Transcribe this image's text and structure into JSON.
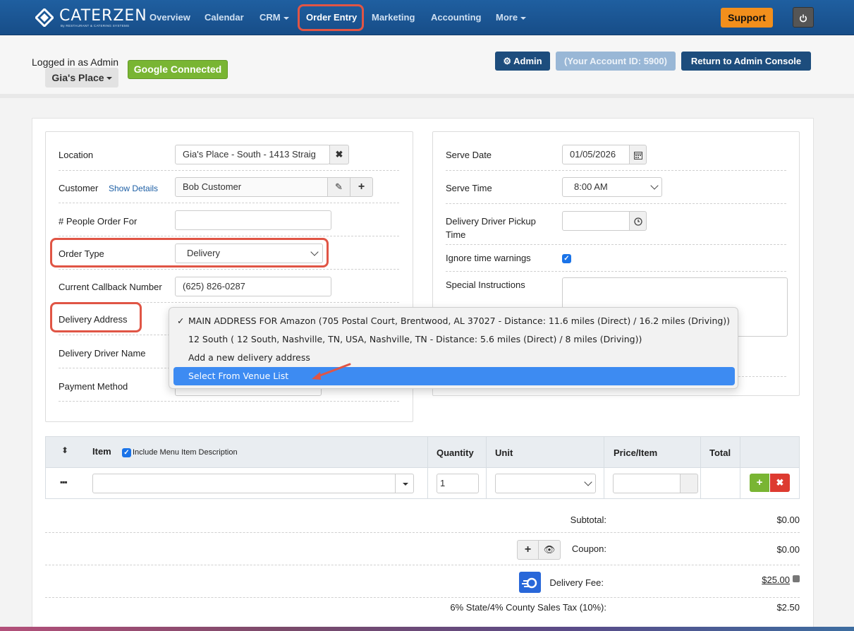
{
  "nav": {
    "logo_text": "CATERZEN",
    "logo_sub": "By RESTAURANT & CATERING SYSTEMS",
    "items": [
      {
        "label": "Overview"
      },
      {
        "label": "Calendar"
      },
      {
        "label": "CRM"
      },
      {
        "label": "Order Entry"
      },
      {
        "label": "Marketing"
      },
      {
        "label": "Accounting"
      },
      {
        "label": "More"
      }
    ],
    "support_label": "Support",
    "power_icon": "power-icon"
  },
  "header": {
    "logged_in": "Logged in as Admin",
    "account_menu": "Gia's Place",
    "google_status": "Google Connected",
    "admin_label": "Admin",
    "account_id": "(Your Account ID: 5900)",
    "return_label": "Return to Admin Console"
  },
  "order": {
    "location_label": "Location",
    "location_value": "Gia's Place - South - 1413 Straig",
    "customer_label": "Customer",
    "show_details": "Show Details",
    "customer_value": "Bob Customer",
    "people_label": "# People Order For",
    "people_value": "",
    "order_type_label": "Order Type",
    "order_type_value": "Delivery",
    "callback_label": "Current Callback Number",
    "callback_value": "(625) 826-0287",
    "delivery_address_label": "Delivery Address",
    "driver_name_label": "Delivery Driver Name",
    "payment_label": "Payment Method"
  },
  "schedule": {
    "serve_date_label": "Serve Date",
    "serve_date_value": "01/05/2026",
    "serve_time_label": "Serve Time",
    "serve_time_value": "8:00 AM",
    "pickup_label_1": "Delivery Driver Pickup",
    "pickup_label_2": "Time",
    "ignore_label": "Ignore time warnings",
    "ignore_checked": true,
    "instructions_label": "Special Instructions"
  },
  "address_dropdown": {
    "options": [
      {
        "label": "MAIN ADDRESS FOR Amazon (705 Postal Court, Brentwood, AL 37027 - Distance: 11.6 miles (Direct) / 16.2 miles (Driving))",
        "checked": true
      },
      {
        "label": "12 South ( 12 South, Nashville, TN, USA, Nashville, TN - Distance: 5.6 miles (Direct) / 8 miles (Driving))",
        "checked": false
      },
      {
        "label": "Add a new delivery address",
        "checked": false
      },
      {
        "label": "Select From Venue List",
        "highlighted": true
      }
    ]
  },
  "items_table": {
    "headers": {
      "item": "Item",
      "include_desc": "Include Menu Item Description",
      "quantity": "Quantity",
      "unit": "Unit",
      "price": "Price/Item",
      "total": "Total"
    },
    "row": {
      "quantity": "1",
      "item": "",
      "unit": "",
      "price": ""
    }
  },
  "totals": {
    "subtotal_label": "Subtotal:",
    "subtotal_value": "$0.00",
    "coupon_label": "Coupon:",
    "coupon_value": "$0.00",
    "delivery_fee_label": "Delivery Fee:",
    "delivery_fee_value": "$25.00",
    "tax_label": "6% State/4% County Sales Tax (10%):",
    "tax_value": "$2.50"
  },
  "colors": {
    "nav_bg": "#1f5fa0",
    "highlight": "#e05545",
    "support": "#f28f1c",
    "google": "#79b533",
    "primary_dark": "#1d4d7d"
  }
}
